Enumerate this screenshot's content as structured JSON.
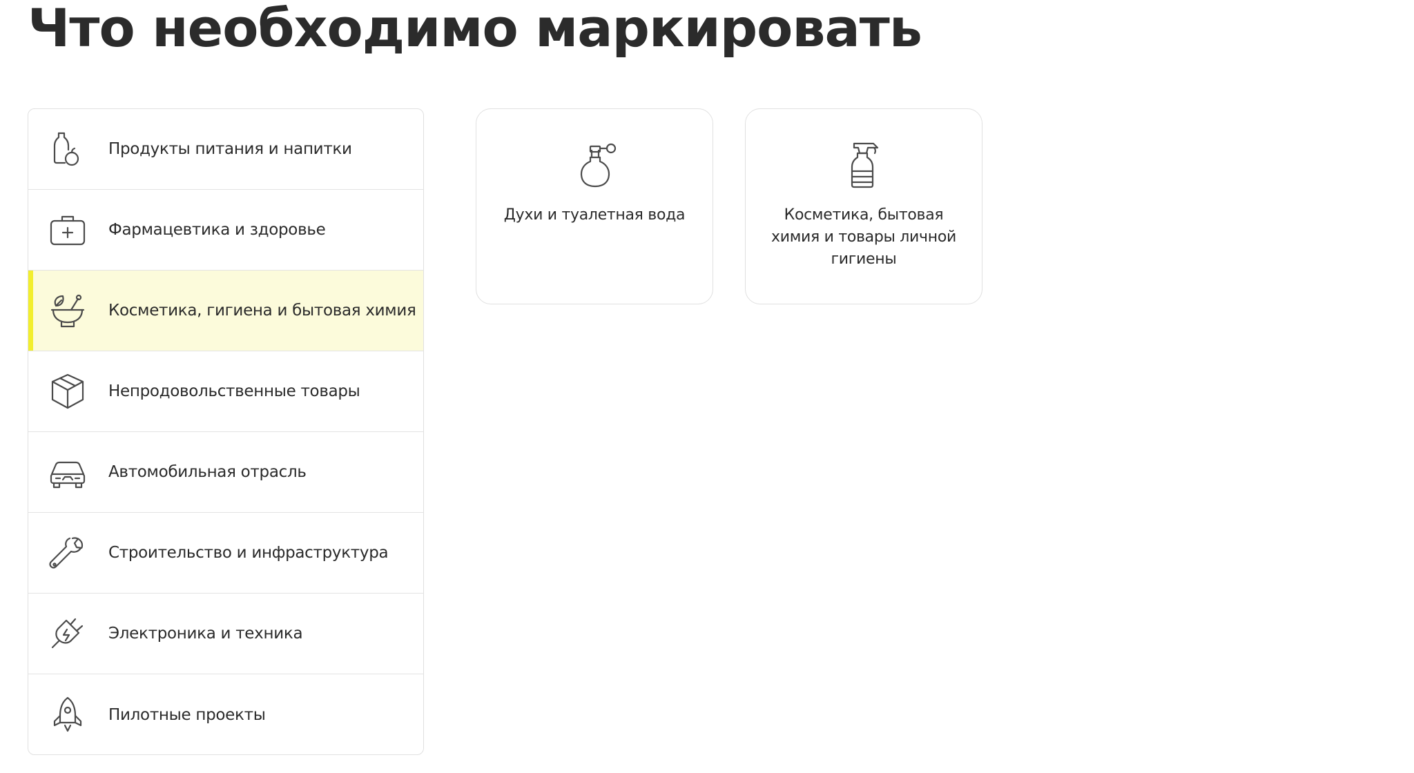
{
  "page": {
    "title": "Что необходимо маркировать"
  },
  "categories": [
    {
      "label": "Продукты питания и напитки",
      "icon": "food-bottle-apple-icon",
      "active": false
    },
    {
      "label": "Фармацевтика и здоровье",
      "icon": "medkit-icon",
      "active": false
    },
    {
      "label": "Косметика, гигиена и бытовая химия",
      "icon": "mortar-leaf-icon",
      "active": true
    },
    {
      "label": "Непродовольственные товары",
      "icon": "box-icon",
      "active": false
    },
    {
      "label": "Автомобильная отрасль",
      "icon": "car-icon",
      "active": false
    },
    {
      "label": "Строительство и инфраструктура",
      "icon": "wrench-icon",
      "active": false
    },
    {
      "label": "Электроника и техника",
      "icon": "plug-icon",
      "active": false
    },
    {
      "label": "Пилотные проекты",
      "icon": "rocket-icon",
      "active": false
    }
  ],
  "cards": [
    {
      "label": "Духи и туалетная вода",
      "icon": "perfume-bottle-icon"
    },
    {
      "label": "Косметика, бытовая химия и товары личной гигиены",
      "icon": "spray-bottle-icon"
    }
  ],
  "colors": {
    "active_background": "#fcfbdb",
    "active_accent": "#f2ee2e",
    "text": "#2a2a2a",
    "border": "#e0e0e0"
  }
}
